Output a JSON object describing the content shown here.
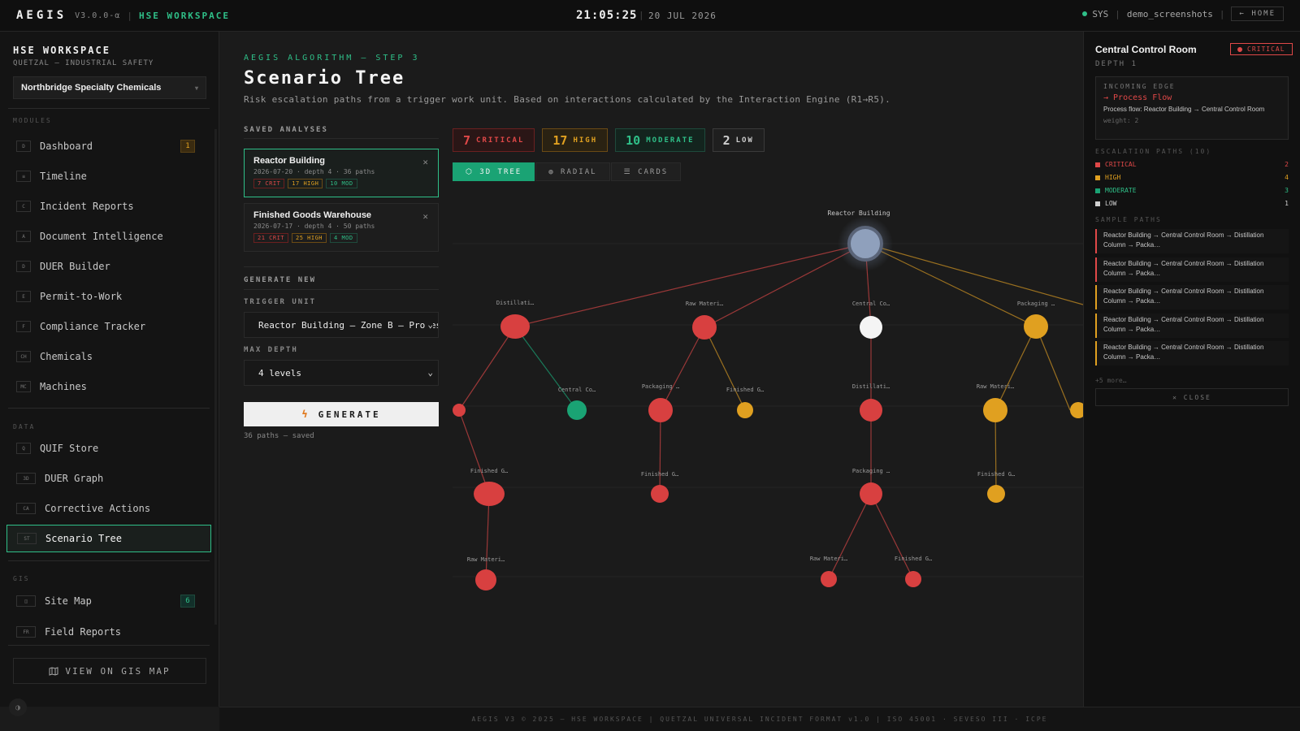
{
  "topbar": {
    "brand": "AEGIS",
    "version": "V3.0.0-α",
    "workspace": "HSE WORKSPACE",
    "time": "21:05:25",
    "date": "20 JUL 2026",
    "sys": "SYS",
    "user": "demo_screenshots",
    "home": "← HOME"
  },
  "sidebar": {
    "title": "HSE WORKSPACE",
    "subtitle": "QUETZAL — INDUSTRIAL SAFETY",
    "company": "Northbridge Specialty Chemicals",
    "sections": {
      "modules": "MODULES",
      "data": "DATA",
      "gis": "GIS"
    },
    "modules": [
      {
        "tag": "D",
        "label": "Dashboard",
        "badge": "1"
      },
      {
        "tag": "≡",
        "label": "Timeline"
      },
      {
        "tag": "C",
        "label": "Incident Reports"
      },
      {
        "tag": "A",
        "label": "Document Intelligence"
      },
      {
        "tag": "D",
        "label": "DUER Builder"
      },
      {
        "tag": "E",
        "label": "Permit-to-Work"
      },
      {
        "tag": "F",
        "label": "Compliance Tracker"
      },
      {
        "tag": "CH",
        "label": "Chemicals"
      },
      {
        "tag": "MC",
        "label": "Machines"
      }
    ],
    "data": [
      {
        "tag": "Q",
        "label": "QUIF Store"
      },
      {
        "tag": "3D",
        "label": "DUER Graph"
      },
      {
        "tag": "CA",
        "label": "Corrective Actions"
      },
      {
        "tag": "ST",
        "label": "Scenario Tree"
      }
    ],
    "gis": [
      {
        "tag": "◫",
        "label": "Site Map",
        "badge": "6"
      },
      {
        "tag": "FR",
        "label": "Field Reports"
      }
    ],
    "gis_button": "VIEW ON GIS MAP",
    "theme_icon": "◑"
  },
  "main": {
    "step": "AEGIS ALGORITHM — STEP 3",
    "title": "Scenario Tree",
    "description": "Risk escalation paths from a trigger work unit. Based on interactions calculated by the Interaction Engine (R1→R5).",
    "saved_label": "SAVED ANALYSES",
    "saved": [
      {
        "name": "Reactor Building",
        "meta": "2026-07-20 · depth 4 · 36 paths",
        "crit": "7 CRIT",
        "high": "17 HIGH",
        "mod": "10 MOD"
      },
      {
        "name": "Finished Goods Warehouse",
        "meta": "2026-07-17 · depth 4 · 50 paths",
        "crit": "21 CRIT",
        "high": "25 HIGH",
        "mod": "4 MOD"
      }
    ],
    "generate_label": "GENERATE NEW",
    "trigger_label": "TRIGGER UNIT",
    "trigger_value": "Reactor Building — Zone B — Process",
    "depth_label": "MAX DEPTH",
    "depth_value": "4 levels",
    "generate_button": "GENERATE",
    "saved_status": "36 paths — saved",
    "counts": [
      {
        "n": "7",
        "label": "CRITICAL"
      },
      {
        "n": "17",
        "label": "HIGH"
      },
      {
        "n": "10",
        "label": "MODERATE"
      },
      {
        "n": "2",
        "label": "LOW"
      }
    ],
    "views": [
      "⬡ 3D TREE",
      "◍ RADIAL",
      "☰ CARDS"
    ],
    "graph_labels": {
      "root": "Reactor Building",
      "n1": "Distillati…",
      "n2": "Raw Materi…",
      "n3": "Central Co…",
      "n4": "Packaging …",
      "n5": "Central Co…",
      "n6": "Packaging …",
      "n7": "Finished G…",
      "n8": "Distillati…",
      "n9": "Raw Materi…",
      "n10": "Finished G…",
      "n11": "Finished G…",
      "n12": "Packaging …",
      "n13": "Finished G…",
      "n14": "Raw Materi…",
      "n15": "Raw Materi…",
      "n16": "Finished G…"
    }
  },
  "panel": {
    "title": "Central Control Room",
    "badge": "CRITICAL",
    "depth": "DEPTH 1",
    "incoming_label": "INCOMING EDGE",
    "edge_type": "→ Process Flow",
    "edge_text": "Process flow: Reactor Building → Central Control Room",
    "weight": "weight: 2",
    "paths_label": "ESCALATION PATHS (10)",
    "levels": [
      {
        "label": "CRITICAL",
        "value": "2"
      },
      {
        "label": "HIGH",
        "value": "4"
      },
      {
        "label": "MODERATE",
        "value": "3"
      },
      {
        "label": "LOW",
        "value": "1"
      }
    ],
    "samples_label": "SAMPLE PATHS",
    "samples": [
      "Reactor Building → Central Control Room → Distillation Column → Packa…",
      "Reactor Building → Central Control Room → Distillation Column → Packa…",
      "Reactor Building → Central Control Room → Distillation Column → Packa…",
      "Reactor Building → Central Control Room → Distillation Column → Packa…",
      "Reactor Building → Central Control Room → Distillation Column → Packa…"
    ],
    "more": "+5 more…",
    "close": "✕ CLOSE"
  },
  "footer": "AEGIS V3 © 2025 — HSE WORKSPACE  |  QUETZAL UNIVERSAL INCIDENT FORMAT v1.0  |  ISO 45001 · SEVESO III · ICPE",
  "colors": {
    "accent": "#2fbf88",
    "critical": "#e04848",
    "high": "#e0a020",
    "moderate": "#1aa374",
    "low": "#cfcfcf"
  }
}
